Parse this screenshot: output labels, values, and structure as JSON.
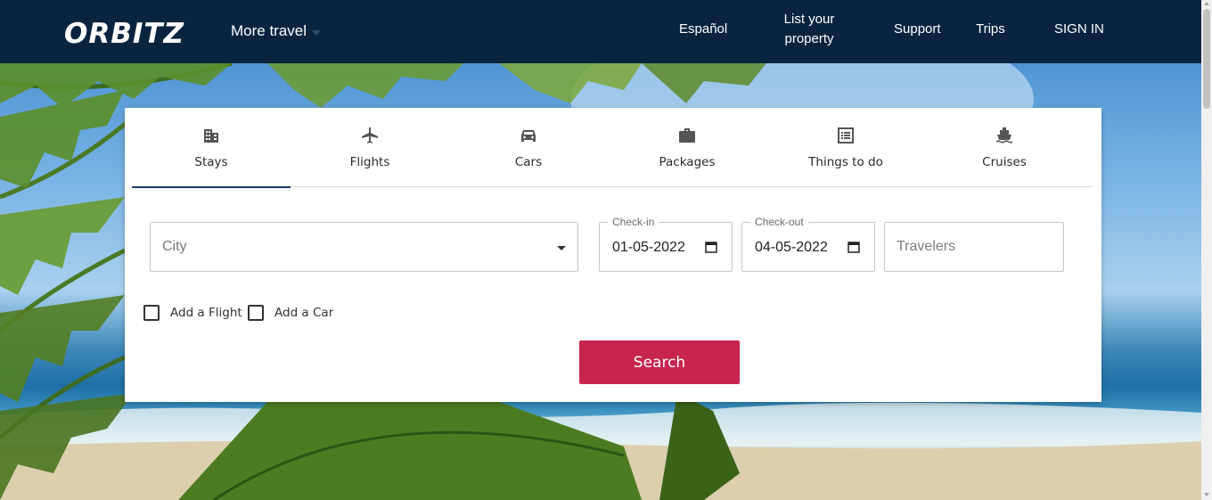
{
  "header": {
    "logo_text": "ORBITZ",
    "more_travel": "More travel",
    "nav": {
      "espanol": "Español",
      "list_property": "List your property",
      "support": "Support",
      "trips": "Trips",
      "sign_in": "SIGN IN"
    }
  },
  "tabs": [
    {
      "label": "Stays",
      "icon": "building-icon",
      "active": true
    },
    {
      "label": "Flights",
      "icon": "plane-icon",
      "active": false
    },
    {
      "label": "Cars",
      "icon": "car-icon",
      "active": false
    },
    {
      "label": "Packages",
      "icon": "suitcase-icon",
      "active": false
    },
    {
      "label": "Things to do",
      "icon": "list-icon",
      "active": false
    },
    {
      "label": "Cruises",
      "icon": "ship-icon",
      "active": false
    }
  ],
  "form": {
    "city_placeholder": "City",
    "checkin_label": "Check-in",
    "checkin_value": "01-05-2022",
    "checkout_label": "Check-out",
    "checkout_value": "04-05-2022",
    "travelers_placeholder": "Travelers",
    "add_flight": "Add a Flight",
    "add_car": "Add a Car",
    "search": "Search"
  },
  "colors": {
    "header_bg": "#0a2440",
    "search_button": "#c7254d",
    "active_tab_underline": "#1e3a6e"
  }
}
